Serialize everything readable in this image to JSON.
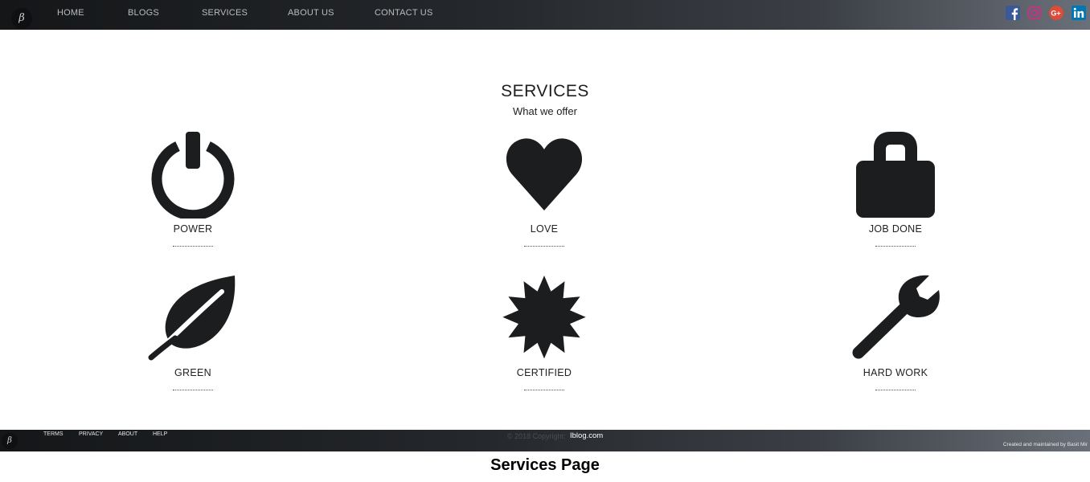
{
  "header": {
    "logo": "β",
    "nav": [
      "HOME",
      "BLOGS",
      "SERVICES",
      "ABOUT US",
      "CONTACT US"
    ],
    "social": [
      {
        "icon": "facebook-icon",
        "color": "#3b5998"
      },
      {
        "icon": "instagram-icon",
        "color": "#c13584"
      },
      {
        "icon": "google-plus-icon",
        "color": "#dd4b39"
      },
      {
        "icon": "linkedin-icon",
        "color": "#0077b5"
      }
    ]
  },
  "main": {
    "title": "SERVICES",
    "subtitle": "What we offer",
    "services": [
      {
        "label": "POWER",
        "icon": "power-icon"
      },
      {
        "label": "LOVE",
        "icon": "heart-icon"
      },
      {
        "label": "JOB DONE",
        "icon": "lock-icon"
      },
      {
        "label": "GREEN",
        "icon": "leaf-icon"
      },
      {
        "label": "CERTIFIED",
        "icon": "certificate-icon"
      },
      {
        "label": "HARD WORK",
        "icon": "wrench-icon"
      }
    ]
  },
  "footer": {
    "logo": "β",
    "links": [
      "TERMS",
      "PRIVACY",
      "ABOUT",
      "HELP"
    ],
    "copyright": "© 2018 Copyright:",
    "site": "Iblog.com",
    "credit": "Created and maintained by Basit Mir"
  },
  "caption": "Services Page",
  "colors": {
    "icon": "#1b1d1f",
    "nav_text": "#b9bcc0"
  }
}
